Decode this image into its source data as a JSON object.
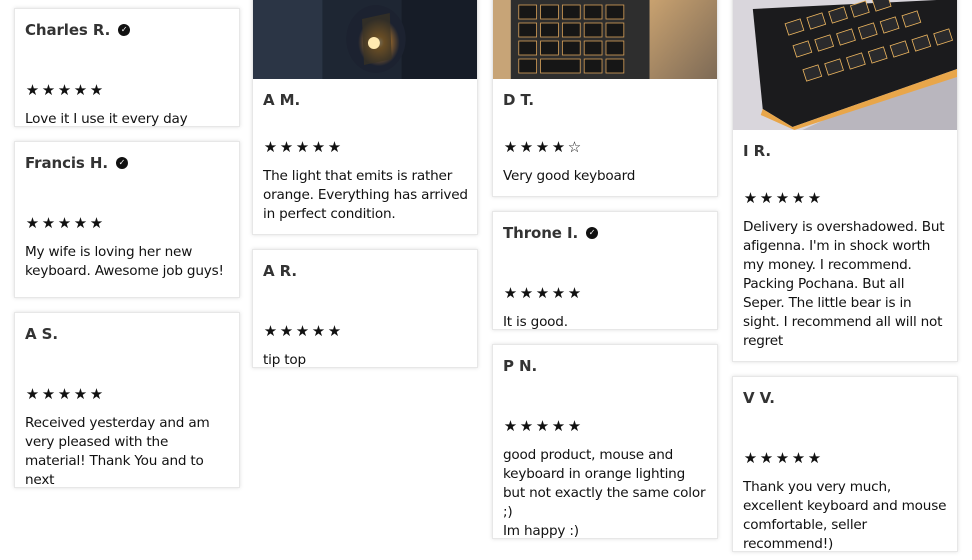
{
  "reviews": [
    {
      "name": "Charles R.",
      "verified": true,
      "rating": 5,
      "text": "Love it I use it every day"
    },
    {
      "name": "Francis H.",
      "verified": true,
      "rating": 5,
      "text": "My wife is loving her new keyboard. Awesome job guys!"
    },
    {
      "name": "A S.",
      "verified": false,
      "rating": 5,
      "text": "Received yesterday and am very pleased with the material! Thank You and to next"
    },
    {
      "name": "A M.",
      "verified": false,
      "rating": 5,
      "text": "The light that emits is rather orange. Everything has arrived in perfect condition."
    },
    {
      "name": "A R.",
      "verified": false,
      "rating": 5,
      "text": "tip top"
    },
    {
      "name": "D T.",
      "verified": false,
      "rating": 4,
      "text": "Very good keyboard"
    },
    {
      "name": "Throne I.",
      "verified": true,
      "rating": 5,
      "text": "It is good."
    },
    {
      "name": "P N.",
      "verified": false,
      "rating": 5,
      "text": "good product, mouse and keyboard in orange lighting but not exactly the same color ;)\nIm happy :)"
    },
    {
      "name": "I R.",
      "verified": false,
      "rating": 5,
      "text": "Delivery is overshadowed. But afigenna. I'm in shock worth my money. I recommend. Packing Pochana. But all Seper. The little bear is in sight. I recommend all will not regret"
    },
    {
      "name": "V V.",
      "verified": false,
      "rating": 5,
      "text": "Thank you very much, excellent keyboard and mouse comfortable, seller recommend!)"
    }
  ],
  "icons": {
    "star_filled": "star-filled-icon",
    "star_empty": "star-empty-icon",
    "verified": "verified-check-icon"
  },
  "colors": {
    "text": "#111111",
    "card_border": "#e7e7e7",
    "name": "#333333"
  }
}
